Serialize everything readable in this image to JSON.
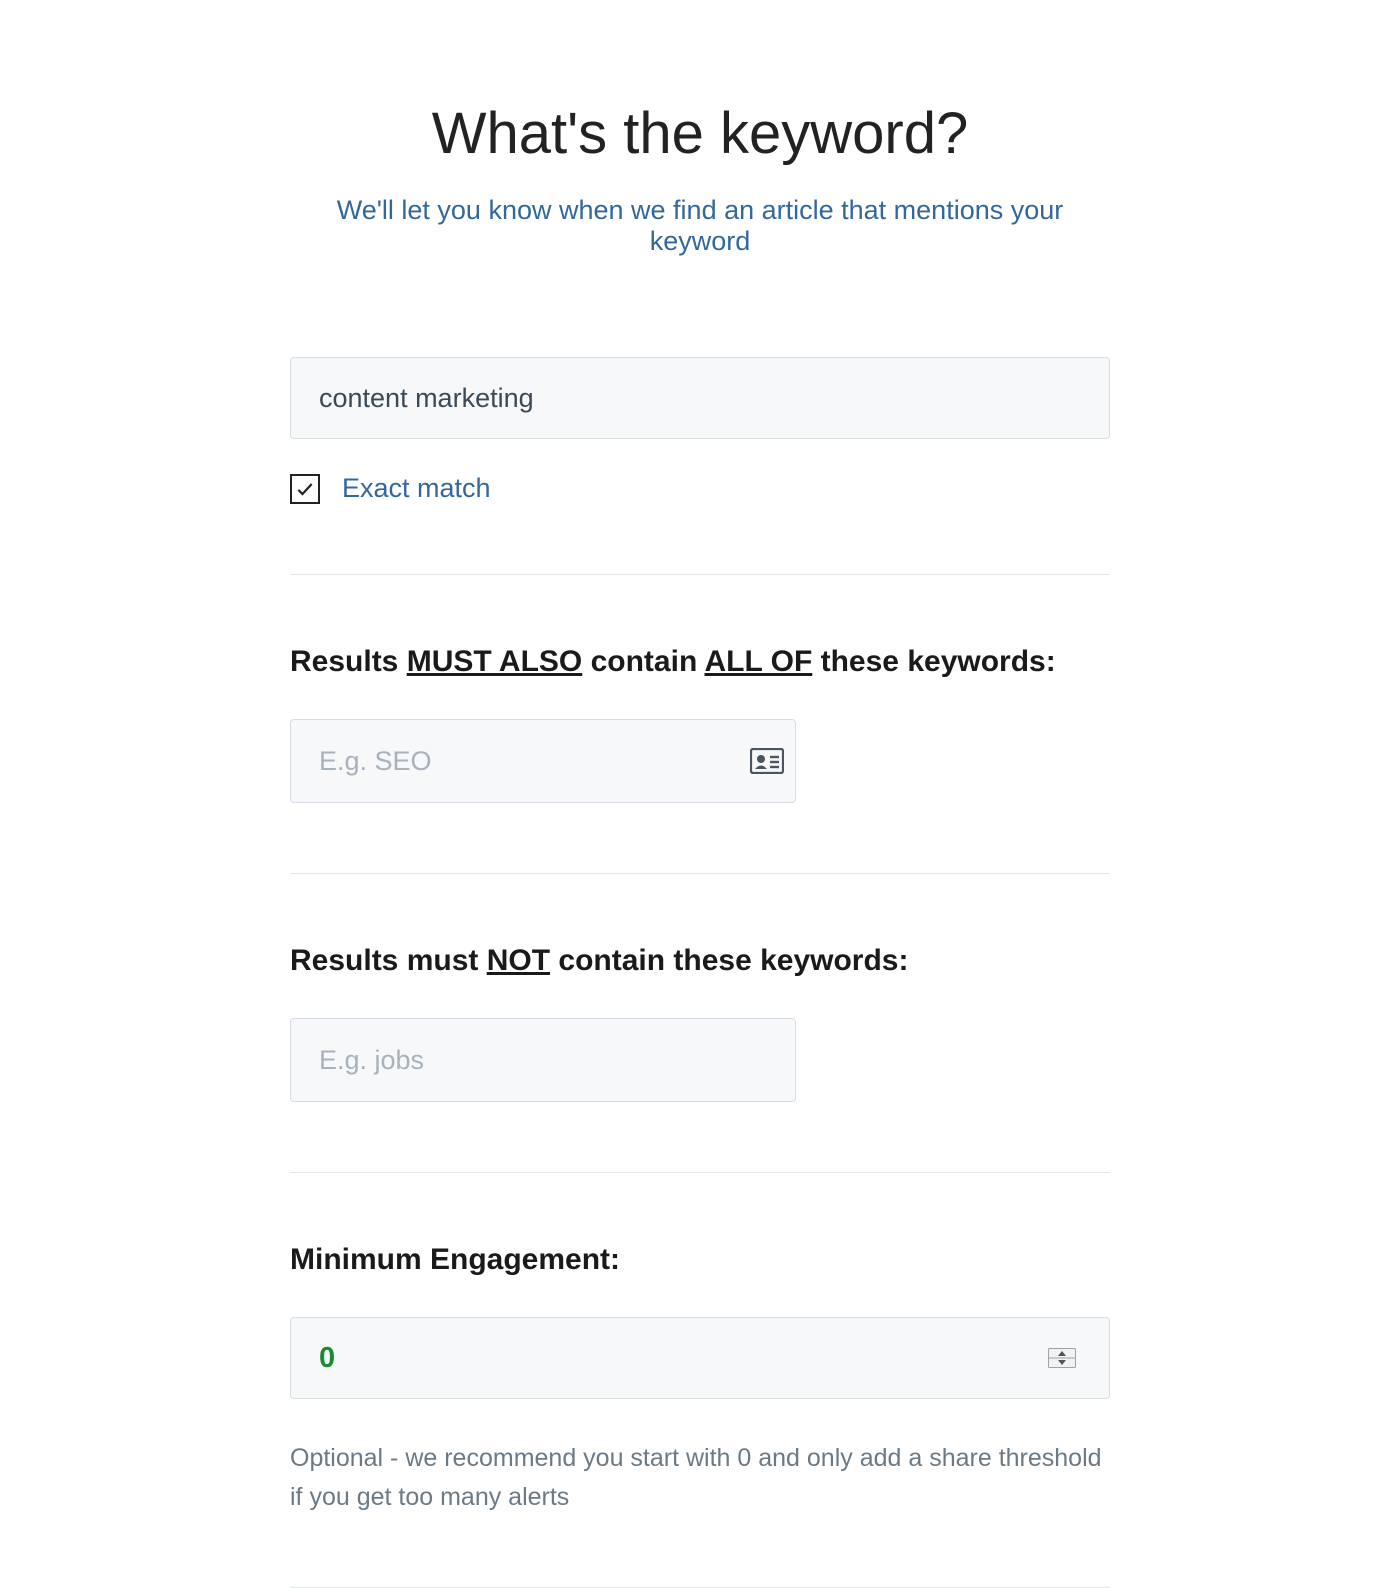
{
  "header": {
    "title": "What's the keyword?",
    "subtitle": "We'll let you know when we find an article that mentions your keyword"
  },
  "keyword": {
    "value": "content marketing",
    "exact_match_checked": true,
    "exact_match_label": "Exact match"
  },
  "must_also": {
    "heading_pre": "Results ",
    "heading_u1": "MUST ALSO",
    "heading_mid": " contain ",
    "heading_u2": "ALL OF",
    "heading_post": " these keywords:",
    "placeholder": "E.g. SEO",
    "value": ""
  },
  "must_not": {
    "heading_pre": "Results must ",
    "heading_u1": "NOT",
    "heading_post": " contain these keywords:",
    "placeholder": "E.g. jobs",
    "value": ""
  },
  "min_engagement": {
    "label": "Minimum Engagement:",
    "value": "0",
    "helper": "Optional - we recommend you start with 0 and only add a share threshold if you get too many alerts"
  }
}
